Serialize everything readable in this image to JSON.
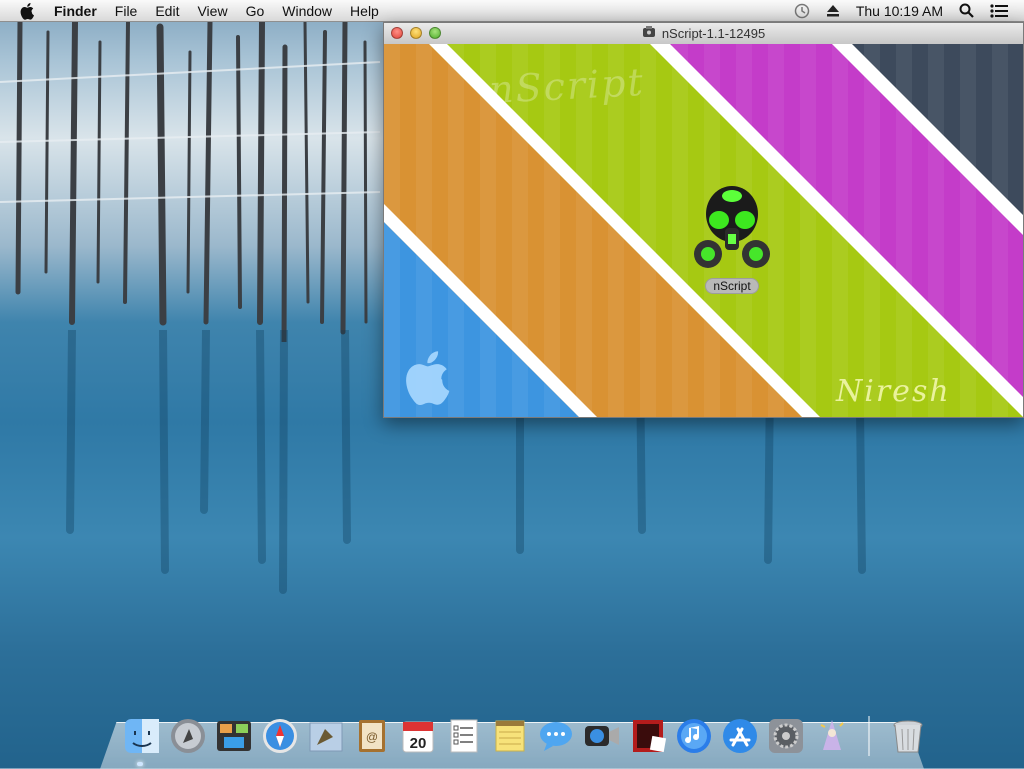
{
  "menubar": {
    "app_name": "Finder",
    "menus": [
      "File",
      "Edit",
      "View",
      "Go",
      "Window",
      "Help"
    ],
    "clock": "Thu 10:19 AM"
  },
  "window": {
    "title": "nScript-1.1-12495",
    "background_text_top": "nScript",
    "background_text_bottom": "Niresh",
    "app_icon_label": "nScript"
  },
  "dock": {
    "calendar_day": "20",
    "items": [
      "finder-icon",
      "launchpad-icon",
      "mission-control-icon",
      "safari-icon",
      "mail-icon",
      "contacts-icon",
      "calendar-icon",
      "reminders-icon",
      "notes-icon",
      "messages-icon",
      "facetime-icon",
      "photo-booth-icon",
      "itunes-icon",
      "app-store-icon",
      "system-preferences-icon",
      "wizard-icon",
      "trash-icon"
    ]
  },
  "colors": {
    "stripe_orange": "#d99233",
    "stripe_green": "#a6c912",
    "stripe_magenta": "#c43cc9",
    "stripe_blue": "#3d95e0",
    "stripe_slate": "#3d4a5c"
  }
}
